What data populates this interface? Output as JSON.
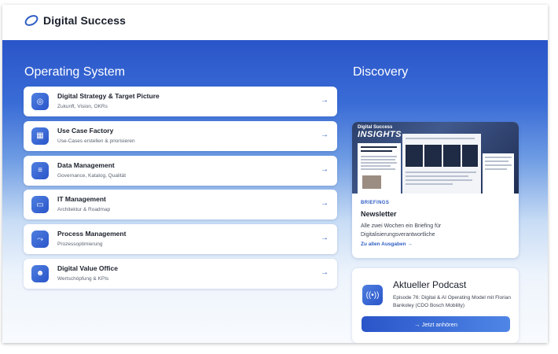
{
  "header": {
    "brand": "Digital Success"
  },
  "operating_system": {
    "title": "Operating System",
    "items": [
      {
        "title": "Digital Strategy & Target Picture",
        "subtitle": "Zukunft, Vision, OKRs",
        "icon": "target-icon"
      },
      {
        "title": "Use Case Factory",
        "subtitle": "Use-Cases erstellen & priorisieren",
        "icon": "grid-icon"
      },
      {
        "title": "Data Management",
        "subtitle": "Governance, Katalog, Qualität",
        "icon": "database-icon"
      },
      {
        "title": "IT Management",
        "subtitle": "Architektur & Roadmap",
        "icon": "laptop-icon"
      },
      {
        "title": "Process Management",
        "subtitle": "Prozessoptimierung",
        "icon": "process-icon"
      },
      {
        "title": "Digital Value Office",
        "subtitle": "Wertschöpfung & KPIs",
        "icon": "team-icon"
      }
    ],
    "arrow": "→"
  },
  "discovery": {
    "title": "Discovery",
    "newsletter": {
      "image_brand_small": "Digital Success",
      "image_brand_big": "INSIGHTS",
      "label": "BRIEFINGS",
      "title": "Newsletter",
      "description": "Alle zwei Wochen ein Briefing für Digitalisierungsverantwortliche",
      "link": "Zu allen Ausgaben →"
    },
    "podcast": {
      "title": "Aktueller Podcast",
      "description": "Episode 76: Digital & AI Operating Model mit Florian Bankoley (CDO Bosch Mobility)",
      "button": "→ Jetzt anhören"
    }
  },
  "colors": {
    "accent": "#2f5ec4",
    "hero_top": "#2a55c9",
    "text_dark": "#1a1f2b"
  }
}
